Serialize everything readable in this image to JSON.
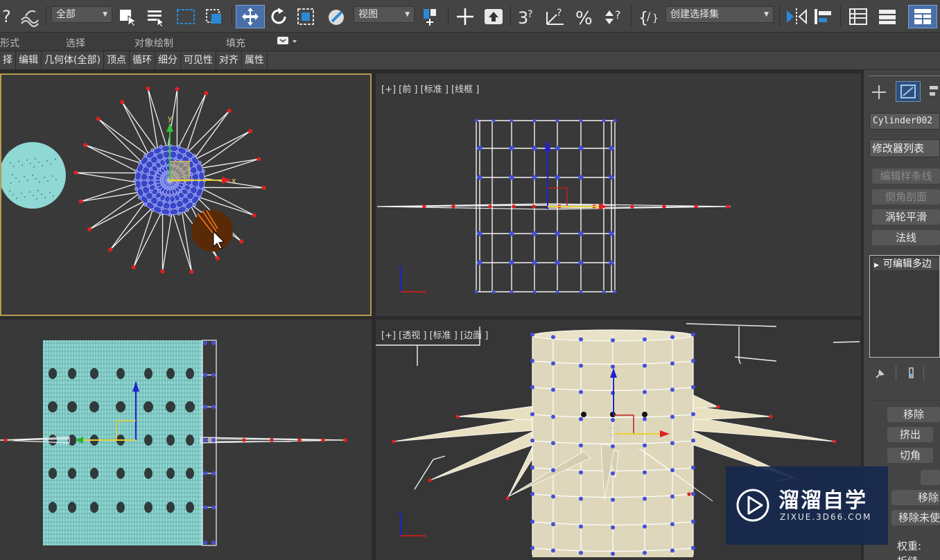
{
  "toolbar": {
    "selection_filter": "全部",
    "ref_coord": "视图",
    "selection_set": "创建选择集",
    "snap_3d": "3",
    "snap_angle_glyph": "?"
  },
  "ribbon": {
    "row1": [
      "形式",
      "选择",
      "对象绘制",
      "填充"
    ],
    "row2": [
      "择",
      "编辑",
      "几何体(全部)",
      "顶点",
      "循环",
      "细分",
      "可见性",
      "对齐",
      "属性"
    ]
  },
  "viewports": {
    "front_label": "[+] [前 ] [标准 ] [线框 ]",
    "persp_label": "[+] [透视 ] [标准 ] [边面 ]"
  },
  "command_panel": {
    "object_name": "Cylinder002",
    "modifier_list": "修改器列表",
    "buttons": [
      {
        "label": "编辑样条线",
        "enabled": false
      },
      {
        "label": "倒角剖面",
        "enabled": false
      },
      {
        "label": "涡轮平滑",
        "enabled": true
      },
      {
        "label": "法线",
        "enabled": true
      }
    ],
    "stack_item": "可编辑多边",
    "edit_buttons": [
      "移除",
      "挤出",
      "切角"
    ],
    "remove_label": "移除",
    "remove_unused": "移除未使",
    "weight_label": "权重:",
    "crease_label": "折缝"
  },
  "watermark": {
    "title": "溜溜自学",
    "url": "ZIXUE.3D66.COM"
  },
  "colors": {
    "active_border": "#b69b4d",
    "vertex_red": "#e02020",
    "vertex_blue": "#4450d8",
    "cyan_mesh": "#8fd8d4"
  }
}
